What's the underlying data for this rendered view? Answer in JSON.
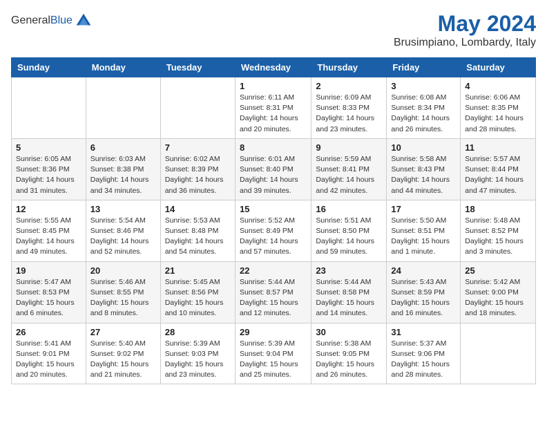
{
  "header": {
    "logo_line1": "General",
    "logo_line2": "Blue",
    "main_title": "May 2024",
    "subtitle": "Brusimpiano, Lombardy, Italy"
  },
  "days_of_week": [
    "Sunday",
    "Monday",
    "Tuesday",
    "Wednesday",
    "Thursday",
    "Friday",
    "Saturday"
  ],
  "weeks": [
    [
      {
        "day": "",
        "info": ""
      },
      {
        "day": "",
        "info": ""
      },
      {
        "day": "",
        "info": ""
      },
      {
        "day": "1",
        "info": "Sunrise: 6:11 AM\nSunset: 8:31 PM\nDaylight: 14 hours\nand 20 minutes."
      },
      {
        "day": "2",
        "info": "Sunrise: 6:09 AM\nSunset: 8:33 PM\nDaylight: 14 hours\nand 23 minutes."
      },
      {
        "day": "3",
        "info": "Sunrise: 6:08 AM\nSunset: 8:34 PM\nDaylight: 14 hours\nand 26 minutes."
      },
      {
        "day": "4",
        "info": "Sunrise: 6:06 AM\nSunset: 8:35 PM\nDaylight: 14 hours\nand 28 minutes."
      }
    ],
    [
      {
        "day": "5",
        "info": "Sunrise: 6:05 AM\nSunset: 8:36 PM\nDaylight: 14 hours\nand 31 minutes."
      },
      {
        "day": "6",
        "info": "Sunrise: 6:03 AM\nSunset: 8:38 PM\nDaylight: 14 hours\nand 34 minutes."
      },
      {
        "day": "7",
        "info": "Sunrise: 6:02 AM\nSunset: 8:39 PM\nDaylight: 14 hours\nand 36 minutes."
      },
      {
        "day": "8",
        "info": "Sunrise: 6:01 AM\nSunset: 8:40 PM\nDaylight: 14 hours\nand 39 minutes."
      },
      {
        "day": "9",
        "info": "Sunrise: 5:59 AM\nSunset: 8:41 PM\nDaylight: 14 hours\nand 42 minutes."
      },
      {
        "day": "10",
        "info": "Sunrise: 5:58 AM\nSunset: 8:43 PM\nDaylight: 14 hours\nand 44 minutes."
      },
      {
        "day": "11",
        "info": "Sunrise: 5:57 AM\nSunset: 8:44 PM\nDaylight: 14 hours\nand 47 minutes."
      }
    ],
    [
      {
        "day": "12",
        "info": "Sunrise: 5:55 AM\nSunset: 8:45 PM\nDaylight: 14 hours\nand 49 minutes."
      },
      {
        "day": "13",
        "info": "Sunrise: 5:54 AM\nSunset: 8:46 PM\nDaylight: 14 hours\nand 52 minutes."
      },
      {
        "day": "14",
        "info": "Sunrise: 5:53 AM\nSunset: 8:48 PM\nDaylight: 14 hours\nand 54 minutes."
      },
      {
        "day": "15",
        "info": "Sunrise: 5:52 AM\nSunset: 8:49 PM\nDaylight: 14 hours\nand 57 minutes."
      },
      {
        "day": "16",
        "info": "Sunrise: 5:51 AM\nSunset: 8:50 PM\nDaylight: 14 hours\nand 59 minutes."
      },
      {
        "day": "17",
        "info": "Sunrise: 5:50 AM\nSunset: 8:51 PM\nDaylight: 15 hours\nand 1 minute."
      },
      {
        "day": "18",
        "info": "Sunrise: 5:48 AM\nSunset: 8:52 PM\nDaylight: 15 hours\nand 3 minutes."
      }
    ],
    [
      {
        "day": "19",
        "info": "Sunrise: 5:47 AM\nSunset: 8:53 PM\nDaylight: 15 hours\nand 6 minutes."
      },
      {
        "day": "20",
        "info": "Sunrise: 5:46 AM\nSunset: 8:55 PM\nDaylight: 15 hours\nand 8 minutes."
      },
      {
        "day": "21",
        "info": "Sunrise: 5:45 AM\nSunset: 8:56 PM\nDaylight: 15 hours\nand 10 minutes."
      },
      {
        "day": "22",
        "info": "Sunrise: 5:44 AM\nSunset: 8:57 PM\nDaylight: 15 hours\nand 12 minutes."
      },
      {
        "day": "23",
        "info": "Sunrise: 5:44 AM\nSunset: 8:58 PM\nDaylight: 15 hours\nand 14 minutes."
      },
      {
        "day": "24",
        "info": "Sunrise: 5:43 AM\nSunset: 8:59 PM\nDaylight: 15 hours\nand 16 minutes."
      },
      {
        "day": "25",
        "info": "Sunrise: 5:42 AM\nSunset: 9:00 PM\nDaylight: 15 hours\nand 18 minutes."
      }
    ],
    [
      {
        "day": "26",
        "info": "Sunrise: 5:41 AM\nSunset: 9:01 PM\nDaylight: 15 hours\nand 20 minutes."
      },
      {
        "day": "27",
        "info": "Sunrise: 5:40 AM\nSunset: 9:02 PM\nDaylight: 15 hours\nand 21 minutes."
      },
      {
        "day": "28",
        "info": "Sunrise: 5:39 AM\nSunset: 9:03 PM\nDaylight: 15 hours\nand 23 minutes."
      },
      {
        "day": "29",
        "info": "Sunrise: 5:39 AM\nSunset: 9:04 PM\nDaylight: 15 hours\nand 25 minutes."
      },
      {
        "day": "30",
        "info": "Sunrise: 5:38 AM\nSunset: 9:05 PM\nDaylight: 15 hours\nand 26 minutes."
      },
      {
        "day": "31",
        "info": "Sunrise: 5:37 AM\nSunset: 9:06 PM\nDaylight: 15 hours\nand 28 minutes."
      },
      {
        "day": "",
        "info": ""
      }
    ]
  ]
}
